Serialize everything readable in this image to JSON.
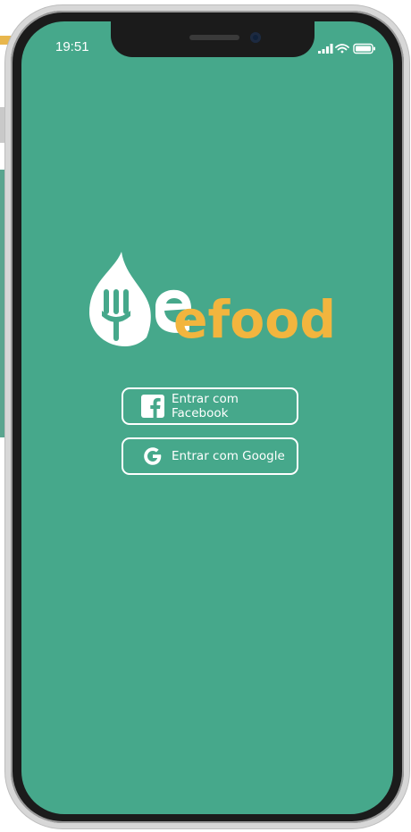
{
  "status_bar": {
    "time": "19:51",
    "signal_icon": "signal-bars-icon",
    "wifi_icon": "wifi-icon",
    "battery_icon": "battery-icon"
  },
  "app": {
    "logo_text": "efood",
    "background_color": "#46a88b",
    "accent_color": "#f2b53e"
  },
  "login": {
    "facebook_label": "Entrar com Facebook",
    "facebook_icon": "facebook-icon",
    "google_label": "Entrar com Google",
    "google_icon": "google-icon"
  }
}
